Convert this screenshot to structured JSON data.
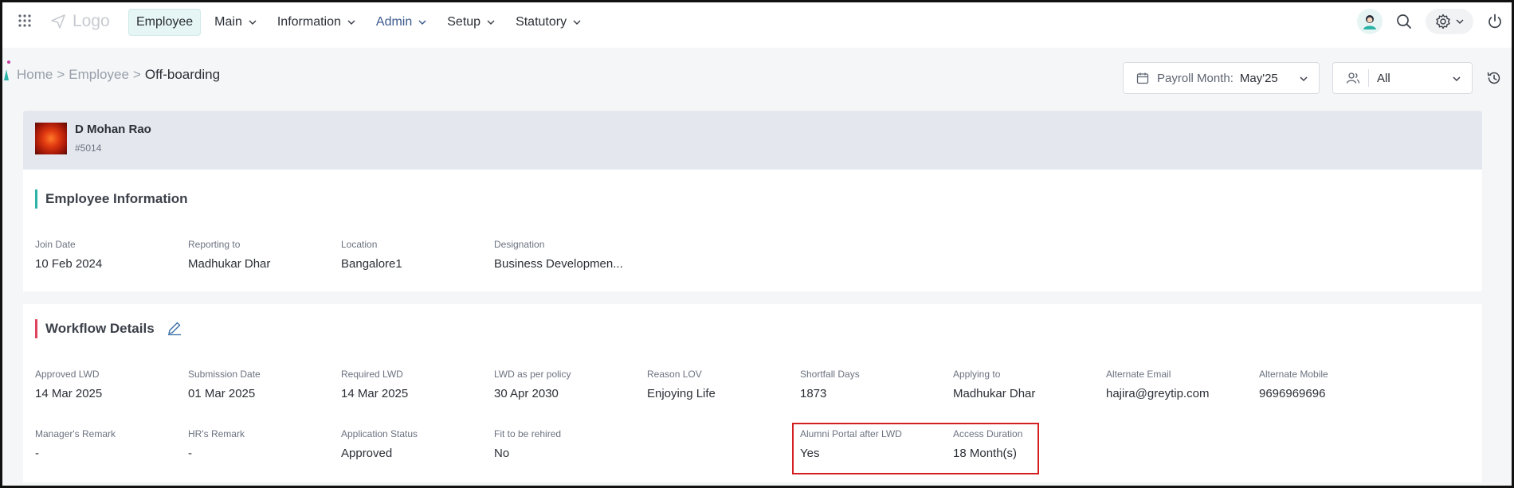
{
  "nav": {
    "logo": "Logo",
    "items": [
      {
        "label": "Employee"
      },
      {
        "label": "Main"
      },
      {
        "label": "Information"
      },
      {
        "label": "Admin"
      },
      {
        "label": "Setup"
      },
      {
        "label": "Statutory"
      }
    ]
  },
  "breadcrumb": {
    "home": "Home",
    "sep1": ">",
    "employee": "Employee",
    "sep2": ">",
    "current": "Off-boarding"
  },
  "payroll": {
    "label": "Payroll Month:",
    "value": "May'25"
  },
  "filter": {
    "value": "All"
  },
  "employee": {
    "name": "D Mohan Rao",
    "id": "#5014"
  },
  "employee_info": {
    "title": "Employee Information",
    "fields": [
      {
        "label": "Join Date",
        "value": "10 Feb 2024"
      },
      {
        "label": "Reporting to",
        "value": "Madhukar Dhar"
      },
      {
        "label": "Location",
        "value": "Bangalore1"
      },
      {
        "label": "Designation",
        "value": "Business Developmen..."
      }
    ]
  },
  "workflow": {
    "title": "Workflow Details",
    "row1": [
      {
        "label": "Approved LWD",
        "value": "14 Mar 2025"
      },
      {
        "label": "Submission Date",
        "value": "01 Mar 2025"
      },
      {
        "label": "Required LWD",
        "value": "14 Mar 2025"
      },
      {
        "label": "LWD as per policy",
        "value": "30 Apr 2030"
      },
      {
        "label": "Reason LOV",
        "value": "Enjoying Life"
      },
      {
        "label": "Shortfall Days",
        "value": "1873"
      },
      {
        "label": "Applying to",
        "value": "Madhukar Dhar"
      },
      {
        "label": "Alternate Email",
        "value": "hajira@greytip.com"
      },
      {
        "label": "Alternate Mobile",
        "value": "9696969696"
      }
    ],
    "row2": [
      {
        "label": "Manager's Remark",
        "value": "-"
      },
      {
        "label": "HR's Remark",
        "value": "-"
      },
      {
        "label": "Application Status",
        "value": "Approved"
      },
      {
        "label": "Fit to be rehired",
        "value": "No"
      },
      {
        "label": "Alumni Portal after LWD",
        "value": "Yes"
      },
      {
        "label": "Access Duration",
        "value": "18 Month(s)"
      }
    ]
  },
  "colors": {
    "accent": "#2bb3a8",
    "workflow_accent": "#e0435e",
    "highlight": "#d31f1f"
  }
}
